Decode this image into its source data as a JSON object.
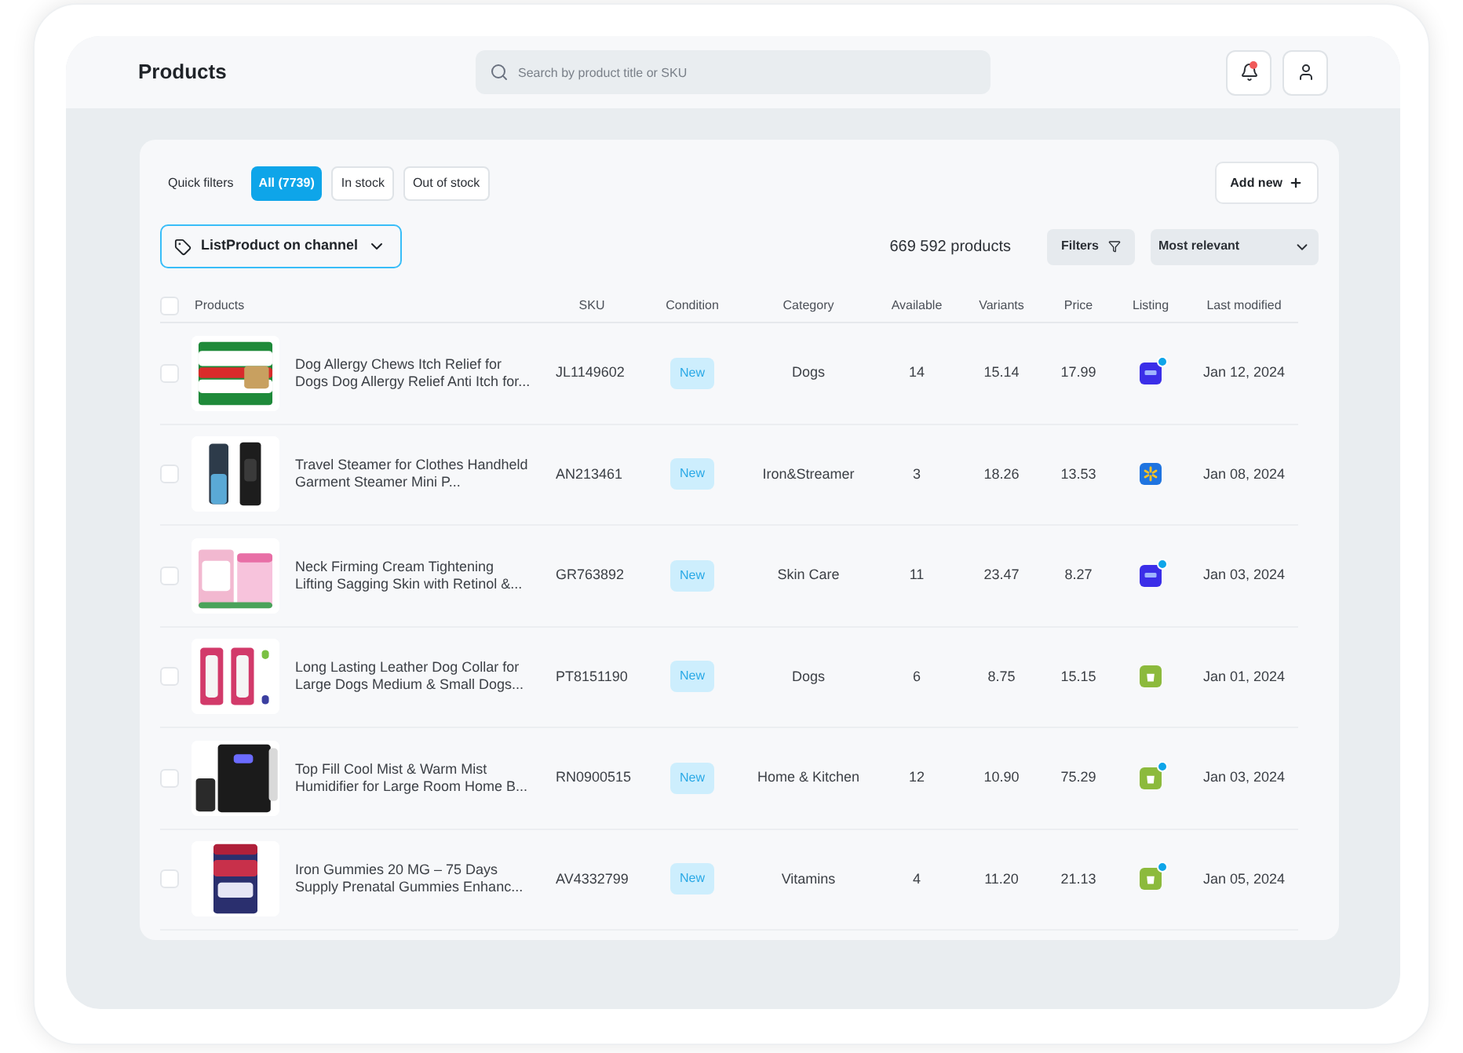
{
  "header": {
    "title": "Products",
    "search": {
      "placeholder": "Search by product title or SKU"
    },
    "notifications": {
      "unread": true
    }
  },
  "toolbar": {
    "quick_filters_label": "Quick filters",
    "quick_filters": [
      {
        "label": "All (7739)",
        "selected": true
      },
      {
        "label": "In stock",
        "selected": false
      },
      {
        "label": "Out of stock",
        "selected": false
      }
    ],
    "add_button": "Add new",
    "channel_select": "ListProduct on channel",
    "count": "669 592 products",
    "filters_button": "Filters",
    "sort_select": "Most relevant"
  },
  "table": {
    "select_all": {
      "checked": false
    },
    "columns": [
      "Products",
      "SKU",
      "Condition",
      "Category",
      "Available",
      "Variants",
      "Price",
      "Listing",
      "Last modified"
    ],
    "rows": [
      {
        "checked": false,
        "title": "Dog Allergy Chews Itch Relief for Dogs Dog Allergy Relief Anti Itch for...",
        "sku": "JL1149602",
        "condition": "New",
        "category": "Dogs",
        "available": "14",
        "variants": "15.14",
        "price": "17.99",
        "listing": {
          "kind": "ebay",
          "badge": true
        },
        "modified": "Jan 12, 2024"
      },
      {
        "checked": false,
        "title": "Travel Steamer for Clothes Handheld Garment Steamer Mini P...",
        "sku": "AN213461",
        "condition": "New",
        "category": "Iron&Streamer",
        "available": "3",
        "variants": "18.26",
        "price": "13.53",
        "listing": {
          "kind": "walmart",
          "badge": false
        },
        "modified": "Jan 08, 2024"
      },
      {
        "checked": false,
        "title": "Neck Firming Cream Tightening Lifting Sagging Skin with Retinol &...",
        "sku": "GR763892",
        "condition": "New",
        "category": "Skin Care",
        "available": "11",
        "variants": "23.47",
        "price": "8.27",
        "listing": {
          "kind": "ebay",
          "badge": true
        },
        "modified": "Jan 03, 2024"
      },
      {
        "checked": false,
        "title": "Long Lasting Leather Dog Collar for Large Dogs Medium & Small Dogs...",
        "sku": "PT8151190",
        "condition": "New",
        "category": "Dogs",
        "available": "6",
        "variants": "8.75",
        "price": "15.15",
        "listing": {
          "kind": "shopify",
          "badge": false
        },
        "modified": "Jan 01, 2024"
      },
      {
        "checked": false,
        "title": "Top Fill Cool Mist & Warm Mist Humidifier for Large Room Home B...",
        "sku": "RN0900515",
        "condition": "New",
        "category": "Home & Kitchen",
        "available": "12",
        "variants": "10.90",
        "price": "75.29",
        "listing": {
          "kind": "shopify",
          "badge": true
        },
        "modified": "Jan 03, 2024"
      },
      {
        "checked": false,
        "title": "Iron Gummies 20 MG – 75 Days Supply Prenatal Gummies Enhanc...",
        "sku": "AV4332799",
        "condition": "New",
        "category": "Vitamins",
        "available": "4",
        "variants": "11.20",
        "price": "21.13",
        "listing": {
          "kind": "shopify",
          "badge": true
        },
        "modified": "Jan 05, 2024"
      }
    ]
  }
}
